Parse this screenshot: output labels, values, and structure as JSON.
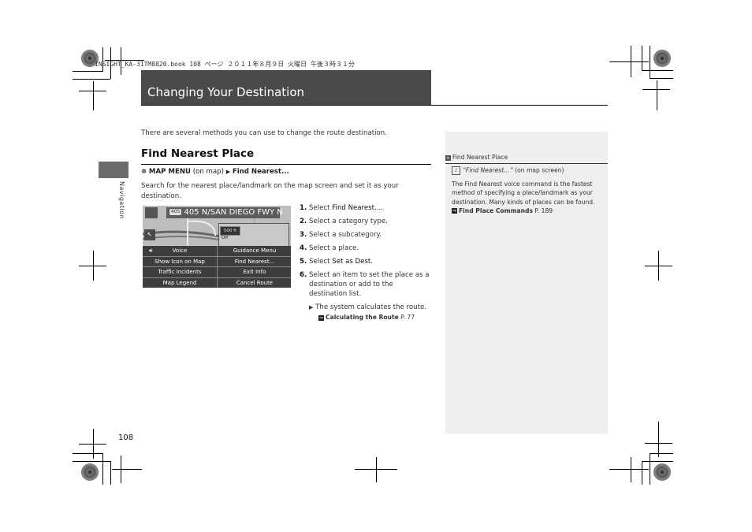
{
  "print_header": "INSIGHT_KA-31TM8820.book  108 ページ  ２０１１年８月９日  火曜日  午後３時３１分",
  "page": {
    "title": "Changing Your Destination",
    "section_tab": "Navigation",
    "page_number": "108",
    "intro": "There are several methods you can use to change the route destination."
  },
  "section": {
    "heading": "Find Nearest Place",
    "path": {
      "icon": "interface-dial-icon",
      "menu": "MAP MENU",
      "context": "(on map)",
      "arrow": "▶",
      "item": "Find Nearest..."
    },
    "description": "Search for the nearest place/landmark on the map screen and set it as your destination."
  },
  "screen": {
    "road_shield": "405",
    "road_name": "405 N/SAN DIEGO FWY N",
    "distance": "500 ft",
    "off_label": "Off",
    "menu": [
      {
        "label": "Voice",
        "icon": "speaker-icon"
      },
      {
        "label": "Guidance Menu"
      },
      {
        "label": "Show Icon on Map"
      },
      {
        "label": "Find Nearest..."
      },
      {
        "label": "Traffic Incidents"
      },
      {
        "label": "Exit Info"
      },
      {
        "label": "Map Legend"
      },
      {
        "label": "Cancel Route"
      }
    ]
  },
  "steps": [
    {
      "num": "1.",
      "pre": "Select ",
      "key": "Find Nearest....",
      "post": ""
    },
    {
      "num": "2.",
      "pre": "Select a category type.",
      "key": "",
      "post": ""
    },
    {
      "num": "3.",
      "pre": "Select a subcategory.",
      "key": "",
      "post": ""
    },
    {
      "num": "4.",
      "pre": "Select a place.",
      "key": "",
      "post": ""
    },
    {
      "num": "5.",
      "pre": "Select ",
      "key": "Set as Dest.",
      "post": ""
    },
    {
      "num": "6.",
      "pre": "Select an item to set the place as a",
      "key": "",
      "post": ""
    }
  ],
  "step6_cont": [
    "destination or add to the",
    "destination list."
  ],
  "result": {
    "arrow": "▶",
    "text": "The system calculates the route.",
    "ref_label": "Calculating the Route",
    "ref_page": "P. 77"
  },
  "sidebar": {
    "title": "Find Nearest Place",
    "voice_command": "“Find Nearest…”",
    "voice_context": "(on map screen)",
    "body": "The Find Nearest voice command is the fastest method of specifying a place/landmark as your destination. Many kinds of places can be found.",
    "ref_label": "Find Place Commands",
    "ref_page": "P. 189"
  }
}
